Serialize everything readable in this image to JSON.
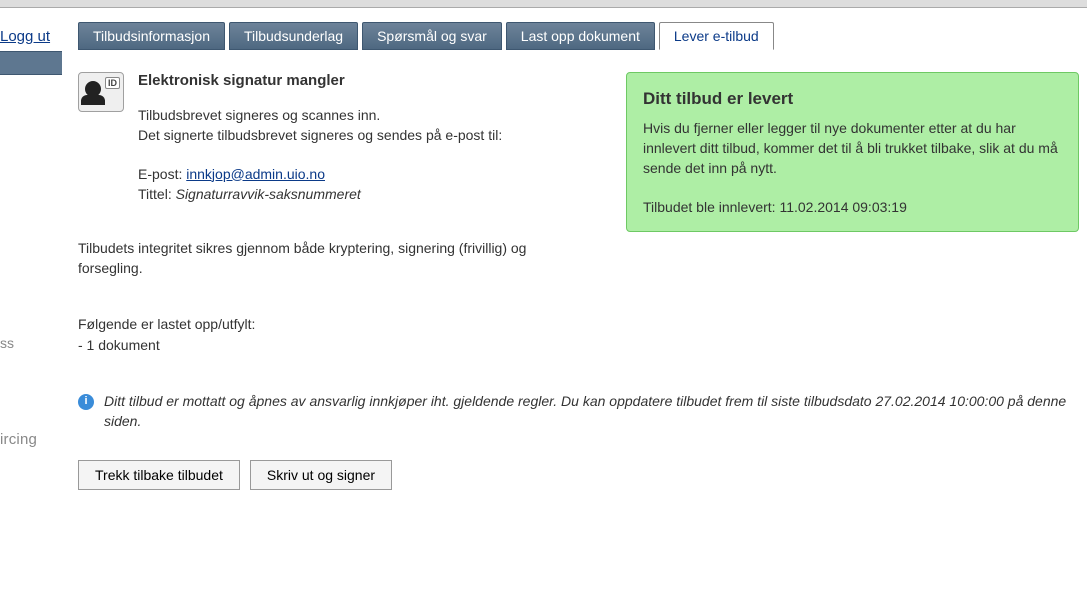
{
  "sidebar": {
    "logout": "Logg ut",
    "ghost1": "ss",
    "ghost2": "ircing"
  },
  "tabs": [
    {
      "label": "Tilbudsinformasjon"
    },
    {
      "label": "Tilbudsunderlag"
    },
    {
      "label": "Spørsmål og svar"
    },
    {
      "label": "Last opp dokument"
    },
    {
      "label": "Lever e-tilbud"
    }
  ],
  "id_badge_text": "ID",
  "signature": {
    "heading": "Elektronisk signatur mangler",
    "line1": "Tilbudsbrevet signeres og scannes inn.",
    "line2": "Det signerte tilbudsbrevet signeres og sendes på e-post til:",
    "email_label": "E-post:",
    "email_value": " innkjop@admin.uio.no",
    "title_label": "Tittel: ",
    "title_value": "Signaturravvik-saksnummeret"
  },
  "integrity": "Tilbudets integritet sikres gjennom både kryptering, signering (frivillig) og forsegling.",
  "uploaded": {
    "heading": "Følgende er lastet opp/utfylt:",
    "item": "- 1 dokument"
  },
  "info_note": "Ditt tilbud er mottatt og åpnes av ansvarlig innkjøper iht. gjeldende regler. Du kan oppdatere tilbudet frem til siste tilbudsdato 27.02.2014 10:00:00 på denne siden.",
  "buttons": {
    "withdraw": "Trekk tilbake tilbudet",
    "print_sign": "Skriv ut og signer"
  },
  "status": {
    "heading": "Ditt tilbud er levert",
    "body": "Hvis du fjerner eller legger til nye dokumenter etter at du har innlevert ditt tilbud, kommer det til å bli trukket tilbake, slik at du må sende det inn på nytt.",
    "time": "Tilbudet ble innlevert: 11.02.2014 09:03:19"
  },
  "colors": {
    "tab_bg": "#5e7790",
    "link": "#0b3a88",
    "status_bg": "#aeeea5",
    "status_border": "#6ec964"
  }
}
